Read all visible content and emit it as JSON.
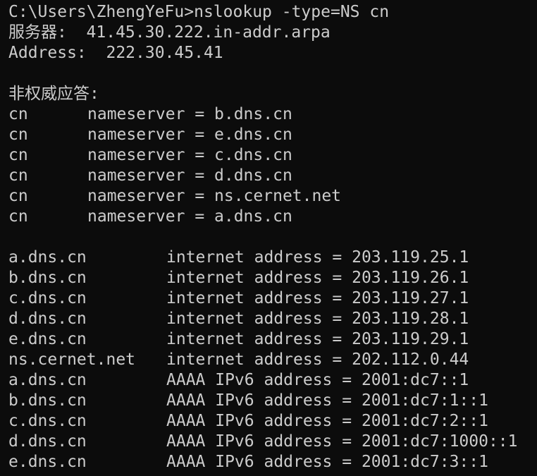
{
  "terminal": {
    "prompt": "C:\\Users\\ZhengYeFu>",
    "command": "nslookup -type=NS cn",
    "server_line": "服务器:  41.45.30.222.in-addr.arpa",
    "address_line": "Address:  222.30.45.41",
    "nonauth_header": "非权威应答:",
    "ns_records": [
      {
        "domain": "cn",
        "value": "nameserver = b.dns.cn"
      },
      {
        "domain": "cn",
        "value": "nameserver = e.dns.cn"
      },
      {
        "domain": "cn",
        "value": "nameserver = c.dns.cn"
      },
      {
        "domain": "cn",
        "value": "nameserver = d.dns.cn"
      },
      {
        "domain": "cn",
        "value": "nameserver = ns.cernet.net"
      },
      {
        "domain": "cn",
        "value": "nameserver = a.dns.cn"
      }
    ],
    "addr_records": [
      {
        "host": "a.dns.cn",
        "value": "internet address = 203.119.25.1"
      },
      {
        "host": "b.dns.cn",
        "value": "internet address = 203.119.26.1"
      },
      {
        "host": "c.dns.cn",
        "value": "internet address = 203.119.27.1"
      },
      {
        "host": "d.dns.cn",
        "value": "internet address = 203.119.28.1"
      },
      {
        "host": "e.dns.cn",
        "value": "internet address = 203.119.29.1"
      },
      {
        "host": "ns.cernet.net",
        "value": "internet address = 202.112.0.44"
      },
      {
        "host": "a.dns.cn",
        "value": "AAAA IPv6 address = 2001:dc7::1"
      },
      {
        "host": "b.dns.cn",
        "value": "AAAA IPv6 address = 2001:dc7:1::1"
      },
      {
        "host": "c.dns.cn",
        "value": "AAAA IPv6 address = 2001:dc7:2::1"
      },
      {
        "host": "d.dns.cn",
        "value": "AAAA IPv6 address = 2001:dc7:1000::1"
      },
      {
        "host": "e.dns.cn",
        "value": "AAAA IPv6 address = 2001:dc7:3::1"
      }
    ],
    "colors": {
      "background": "#0c0c0c",
      "foreground": "#cccccc"
    }
  }
}
